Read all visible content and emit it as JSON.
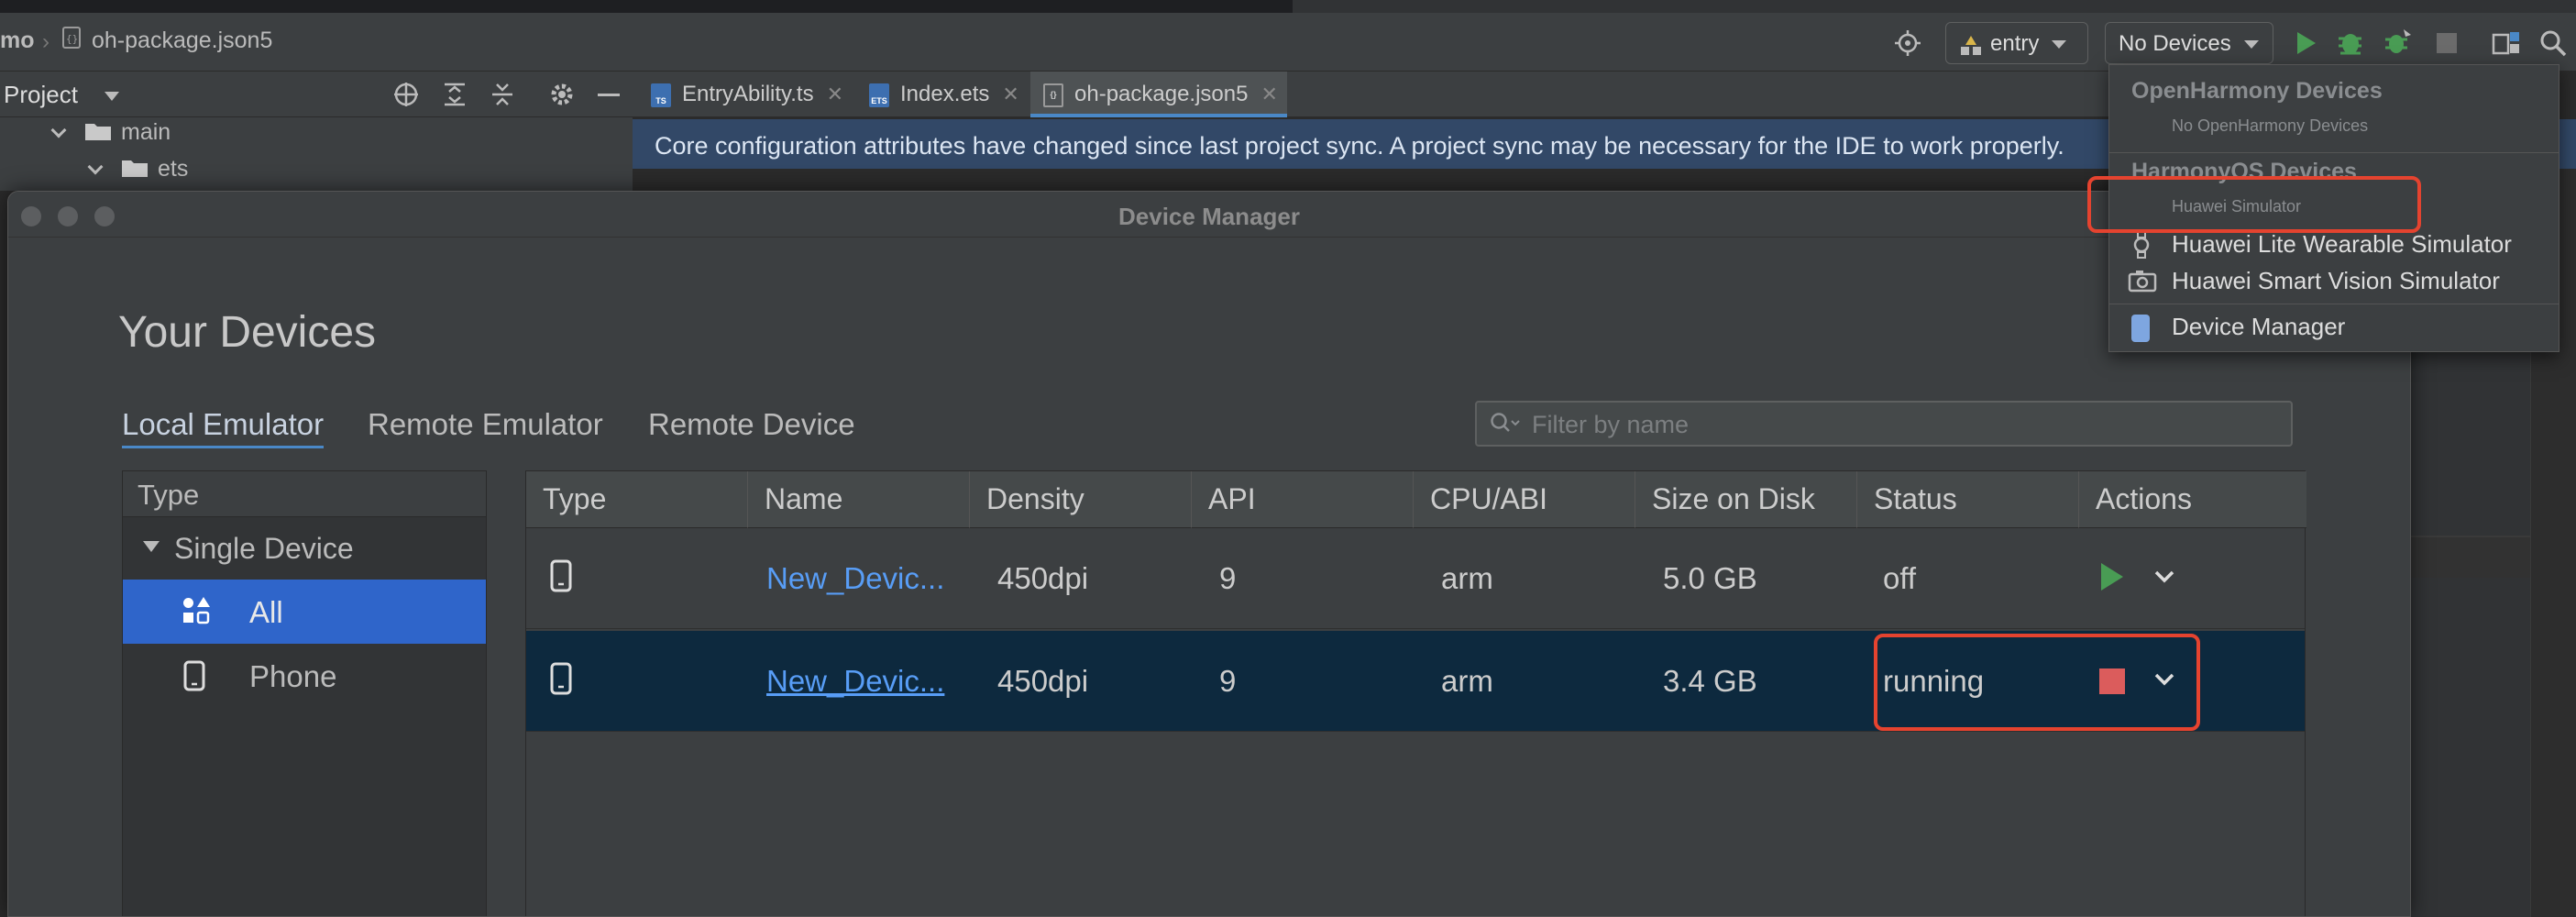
{
  "navbar": {
    "project_crumb": "mo",
    "file_crumb": "oh-package.json5",
    "module_combo": "entry",
    "device_combo": "No Devices"
  },
  "project_pane": {
    "title": "Project",
    "tree": [
      {
        "label": "main"
      },
      {
        "label": "ets"
      }
    ]
  },
  "editor": {
    "tabs": [
      {
        "label": "EntryAbility.ts",
        "badge": "TS"
      },
      {
        "label": "Index.ets",
        "badge": "ETS"
      },
      {
        "label": "oh-package.json5",
        "badge": "{}"
      }
    ],
    "active_tab": "oh-package.json5",
    "banner": "Core configuration attributes have changed since last project sync. A project sync may be necessary for the IDE to work properly."
  },
  "device_manager": {
    "title": "Device Manager",
    "heading": "Your Devices",
    "tabs": [
      "Local Emulator",
      "Remote Emulator",
      "Remote Device"
    ],
    "active_tab": "Local Emulator",
    "filter_placeholder": "Filter by name",
    "type_panel": {
      "header": "Type",
      "group": "Single Device",
      "items": [
        {
          "label": "All",
          "selected": true,
          "icon": "grid-icon"
        },
        {
          "label": "Phone",
          "selected": false,
          "icon": "phone-icon"
        }
      ]
    },
    "table": {
      "columns": [
        "Type",
        "Name",
        "Density",
        "API",
        "CPU/ABI",
        "Size on Disk",
        "Status",
        "Actions"
      ],
      "rows": [
        {
          "type_icon": "phone-icon",
          "name": "New_Devic...",
          "density": "450dpi",
          "api": "9",
          "cpu": "arm",
          "size": "5.0 GB",
          "status": "off",
          "action": "play"
        },
        {
          "type_icon": "phone-icon",
          "name": "New_Devic...",
          "density": "450dpi",
          "api": "9",
          "cpu": "arm",
          "size": "3.4 GB",
          "status": "running",
          "action": "stop"
        }
      ]
    }
  },
  "device_dropdown": {
    "openharmony_header": "OpenHarmony Devices",
    "openharmony_empty": "No OpenHarmony Devices",
    "harmonyos_header": "HarmonyOS Devices",
    "huawei_simulator": "Huawei Simulator",
    "wearable": "Huawei Lite Wearable Simulator",
    "smart_vision": "Huawei Smart Vision Simulator",
    "device_manager": "Device Manager"
  },
  "colors": {
    "accent": "#4a88c7",
    "selection": "#2f65ca",
    "link": "#589df6",
    "run": "#499c54",
    "stop": "#db5c5c",
    "highlight": "#e5432f"
  }
}
